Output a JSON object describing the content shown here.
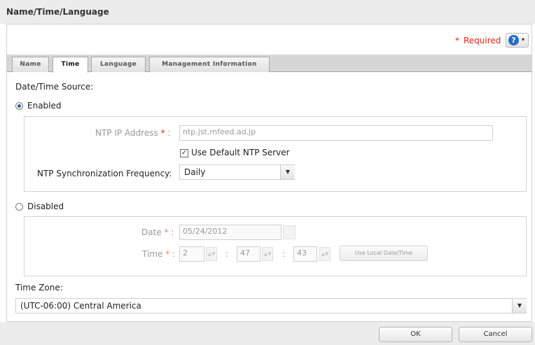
{
  "window": {
    "title": "Name/Time/Language"
  },
  "header": {
    "required_label": "Required",
    "required_mark": "*",
    "help_glyph": "?",
    "help_caret": "▾"
  },
  "tabs": [
    {
      "label": "Name",
      "active": false
    },
    {
      "label": "Time",
      "active": true
    },
    {
      "label": "Language",
      "active": false
    },
    {
      "label": "Management Information",
      "active": false
    }
  ],
  "time": {
    "source_label": "Date/Time Source:",
    "enabled_label": "Enabled",
    "enabled_selected": true,
    "ntp_ip_label": "NTP IP Address",
    "ntp_ip_value": "ntp.jst.mfeed.ad.jp",
    "use_default_label": "Use Default NTP Server",
    "use_default_checked": true,
    "sync_freq_label": "NTP Synchronization Frequency:",
    "sync_freq_value": "Daily",
    "disabled_label": "Disabled",
    "disabled_selected": false,
    "date_label": "Date",
    "date_value": "05/24/2012",
    "time_label": "Time",
    "time_hour": "2",
    "time_minute": "47",
    "time_second": "43",
    "time_sep": ":",
    "label_suffix": ":",
    "use_local_label": "Use Local Date/Time",
    "timezone_label": "Time Zone:",
    "timezone_value": "(UTC-06:00) Central America"
  },
  "icons": {
    "dropdown": "chevron-down-icon",
    "spinner": "spinner-arrows-icon",
    "calendar": "calendar-icon",
    "help": "help-icon"
  },
  "footer": {
    "ok_label": "OK",
    "cancel_label": "Cancel"
  },
  "colors": {
    "required": "#e2231a",
    "help_blue": "#1f6fc7"
  }
}
